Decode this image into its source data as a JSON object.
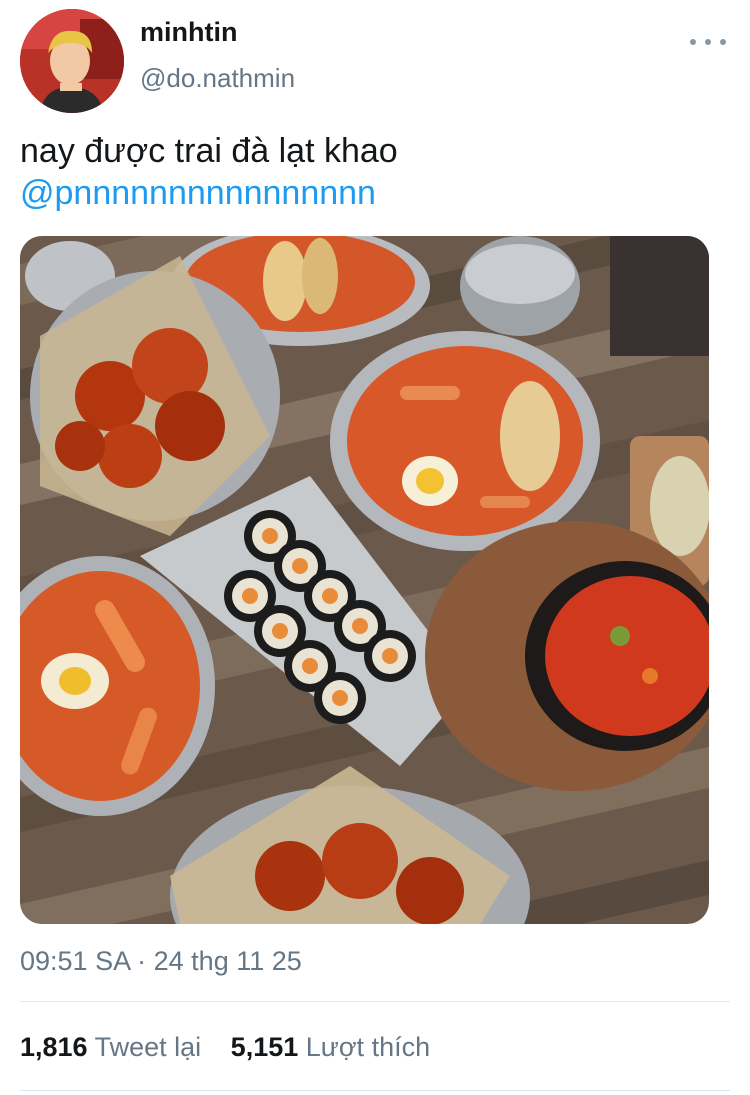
{
  "author": {
    "display_name": "minhtin",
    "handle": "@do.nathmin"
  },
  "tweet": {
    "text": "nay được trai đà lạt khao",
    "mention": "@pnnnnnnnnnnnnnnnn",
    "time": "09:51 SA",
    "separator": "·",
    "date": "24 thg 11 25"
  },
  "stats": {
    "retweets_count": "1,816",
    "retweets_label": "Tweet lại",
    "likes_count": "5,151",
    "likes_label": "Lượt thích"
  },
  "icons": {
    "more": "more-horizontal-icon"
  },
  "colors": {
    "link": "#1d9bf0",
    "secondary_text": "#657786",
    "primary_text": "#14171a"
  }
}
